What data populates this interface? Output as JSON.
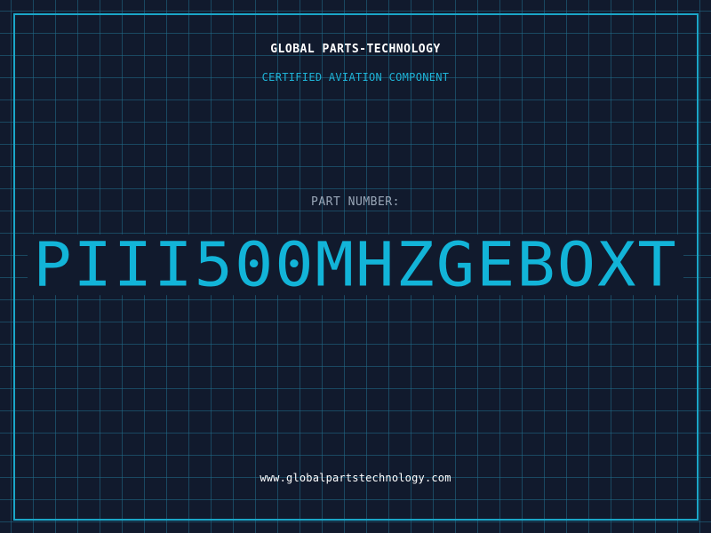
{
  "header": {
    "company_name": "GLOBAL PARTS-TECHNOLOGY",
    "tagline": "CERTIFIED AVIATION COMPONENT"
  },
  "part": {
    "label": "PART NUMBER:",
    "number": "PIII500MHZGEBOXT"
  },
  "footer": {
    "website": "www.globalpartstechnology.com"
  },
  "colors": {
    "background": "#111a2d",
    "grid": "#206e8c",
    "frame": "#1aa6c8",
    "accent": "#12b4d8",
    "label": "#9aa7b8",
    "text": "#ffffff"
  }
}
